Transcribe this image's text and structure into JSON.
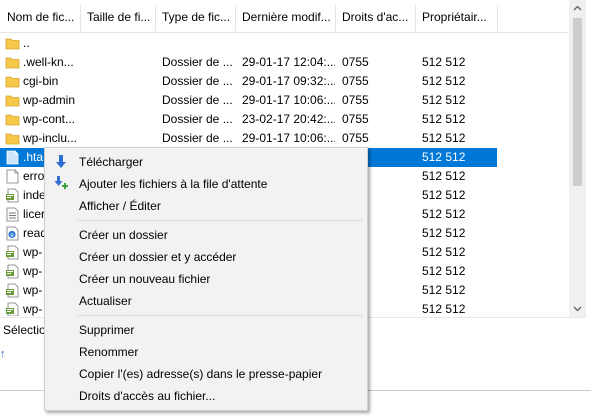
{
  "columns": [
    "Nom de fic...",
    "Taille de fi...",
    "Type de fic...",
    "Dernière modif...",
    "Droits d'ac...",
    "Propriétair..."
  ],
  "rows": [
    {
      "name": "..",
      "size": "",
      "type": "",
      "modified": "",
      "perms": "",
      "owner": "",
      "icon": "folder-icon"
    },
    {
      "name": ".well-kn...",
      "size": "",
      "type": "Dossier de ...",
      "modified": "29-01-17 12:04:...",
      "perms": "0755",
      "owner": "512 512",
      "icon": "folder-icon"
    },
    {
      "name": "cgi-bin",
      "size": "",
      "type": "Dossier de ...",
      "modified": "29-01-17 09:32:...",
      "perms": "0755",
      "owner": "512 512",
      "icon": "folder-icon"
    },
    {
      "name": "wp-admin",
      "size": "",
      "type": "Dossier de ...",
      "modified": "29-01-17 10:06:...",
      "perms": "0755",
      "owner": "512 512",
      "icon": "folder-icon"
    },
    {
      "name": "wp-cont...",
      "size": "",
      "type": "Dossier de ...",
      "modified": "23-02-17 20:42:...",
      "perms": "0755",
      "owner": "512 512",
      "icon": "folder-icon"
    },
    {
      "name": "wp-inclu...",
      "size": "",
      "type": "Dossier de ...",
      "modified": "29-01-17 10:06:...",
      "perms": "0755",
      "owner": "512 512",
      "icon": "folder-icon"
    },
    {
      "name": ".hta",
      "size": "",
      "type": "",
      "modified": "",
      "perms": "",
      "owner": "512 512",
      "icon": "file-icon",
      "selected": true
    },
    {
      "name": "erro",
      "size": "",
      "type": "",
      "modified": "",
      "perms": "",
      "owner": "512 512",
      "icon": "file-icon"
    },
    {
      "name": "inde",
      "size": "",
      "type": "",
      "modified": "",
      "perms": "",
      "owner": "512 512",
      "icon": "script-file-icon"
    },
    {
      "name": "licer",
      "size": "",
      "type": "",
      "modified": "",
      "perms": "",
      "owner": "512 512",
      "icon": "text-file-icon"
    },
    {
      "name": "read",
      "size": "",
      "type": "",
      "modified": "",
      "perms": "",
      "owner": "512 512",
      "icon": "html-file-icon"
    },
    {
      "name": "wp-",
      "size": "",
      "type": "",
      "modified": "",
      "perms": "",
      "owner": "512 512",
      "icon": "script-file-icon"
    },
    {
      "name": "wp-",
      "size": "",
      "type": "",
      "modified": "",
      "perms": "",
      "owner": "512 512",
      "icon": "script-file-icon"
    },
    {
      "name": "wp-",
      "size": "",
      "type": "",
      "modified": "",
      "perms": "",
      "owner": "512 512",
      "icon": "script-file-icon"
    },
    {
      "name": "wp-",
      "size": "",
      "type": "",
      "modified": "",
      "perms": "",
      "owner": "512 512",
      "icon": "script-file-icon"
    }
  ],
  "status_text": "Sélection",
  "context_menu": {
    "items": [
      {
        "label": "Télécharger",
        "icon": "download-icon"
      },
      {
        "label": "Ajouter les fichiers à la file d'attente",
        "icon": "add-to-queue-icon"
      },
      {
        "label": "Afficher / Éditer",
        "icon": ""
      },
      {
        "separator": true
      },
      {
        "label": "Créer un dossier",
        "icon": ""
      },
      {
        "label": "Créer un dossier et y accéder",
        "icon": ""
      },
      {
        "label": "Créer un nouveau fichier",
        "icon": ""
      },
      {
        "label": "Actualiser",
        "icon": ""
      },
      {
        "separator": true
      },
      {
        "label": "Supprimer",
        "icon": ""
      },
      {
        "label": "Renommer",
        "icon": ""
      },
      {
        "label": "Copier l'(es) adresse(s) dans le presse-papier",
        "icon": ""
      },
      {
        "label": "Droits d'accès au fichier...",
        "icon": ""
      }
    ]
  },
  "colors": {
    "selection": "#0078d7",
    "folder": "#f5c84a",
    "menu_bg": "#f2f2f2"
  }
}
